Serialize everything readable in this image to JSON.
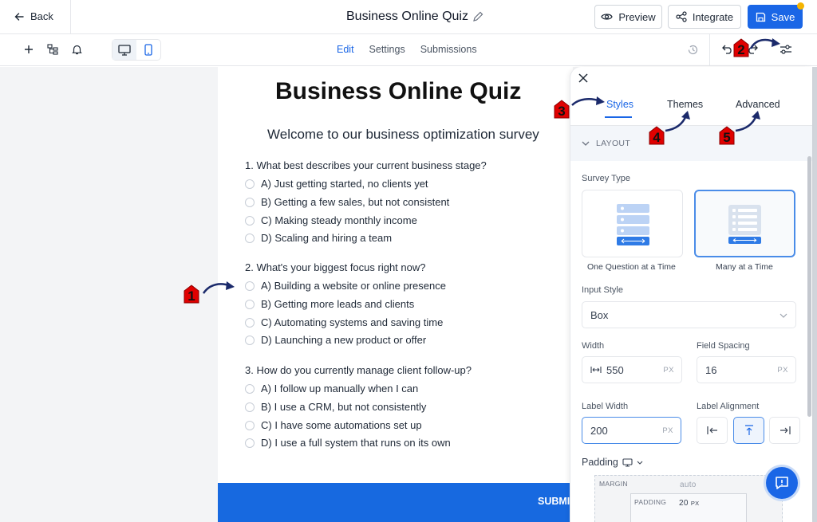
{
  "topbar": {
    "back_label": "Back",
    "title": "Business Online Quiz",
    "preview_label": "Preview",
    "integrate_label": "Integrate",
    "save_label": "Save"
  },
  "subbar": {
    "tabs": [
      {
        "label": "Edit",
        "active": true
      },
      {
        "label": "Settings",
        "active": false
      },
      {
        "label": "Submissions",
        "active": false
      }
    ]
  },
  "form": {
    "title": "Business Online Quiz",
    "subtitle": "Welcome to our business optimization survey",
    "questions": [
      {
        "text": "1. What best describes your current business stage?",
        "options": [
          "A) Just getting started, no clients yet",
          "B) Getting a few sales, but not consistent",
          "C) Making steady monthly income",
          "D) Scaling and hiring a team"
        ]
      },
      {
        "text": "2. What's your biggest focus right now?",
        "options": [
          "A) Building a website or online presence",
          "B) Getting more leads and clients",
          "C) Automating systems and saving time",
          "D) Launching a new product or offer"
        ]
      },
      {
        "text": "3. How do you currently manage client follow-up?",
        "options": [
          "A) I follow up manually when I can",
          "B) I use a CRM, but not consistently",
          "C) I have some automations set up",
          "D) I use a full system that runs on its own"
        ]
      }
    ],
    "submit_label": "SUBMIT"
  },
  "panel": {
    "tabs": [
      {
        "label": "Styles",
        "active": true
      },
      {
        "label": "Themes",
        "active": false
      },
      {
        "label": "Advanced",
        "active": false
      }
    ],
    "section_title": "LAYOUT",
    "survey_type_label": "Survey Type",
    "survey_types": [
      {
        "label": "One Question at a Time",
        "selected": false
      },
      {
        "label": "Many at a Time",
        "selected": true
      }
    ],
    "input_style_label": "Input Style",
    "input_style_value": "Box",
    "width_label": "Width",
    "width_value": "550",
    "field_spacing_label": "Field Spacing",
    "field_spacing_value": "16",
    "label_width_label": "Label Width",
    "label_width_value": "200",
    "label_alignment_label": "Label Alignment",
    "label_alignment_selected": "top",
    "unit": "PX",
    "padding_label": "Padding",
    "margin_label": "MARGIN",
    "margin_value": "auto",
    "padding_box_label": "PADDING",
    "padding_value": "20",
    "padding_unit": "PX"
  },
  "callouts": [
    "1",
    "2",
    "3",
    "4",
    "5"
  ],
  "colors": {
    "accent": "#1a66e6",
    "submit_bar": "#1769e0",
    "callout_red": "#e00000",
    "arrow_navy": "#1b2a6b",
    "notification_dot": "#f5b400"
  },
  "icons": [
    "arrow-left-icon",
    "pencil-icon",
    "eye-icon",
    "share-nodes-icon",
    "save-disk-icon",
    "plus-icon",
    "layout-tree-icon",
    "bell-icon",
    "monitor-icon",
    "phone-icon",
    "history-icon",
    "undo-icon",
    "redo-icon",
    "sliders-icon",
    "close-icon",
    "chevron-down-icon",
    "width-arrows-icon",
    "align-left-icon",
    "align-top-icon",
    "align-right-icon",
    "chat-support-icon"
  ]
}
